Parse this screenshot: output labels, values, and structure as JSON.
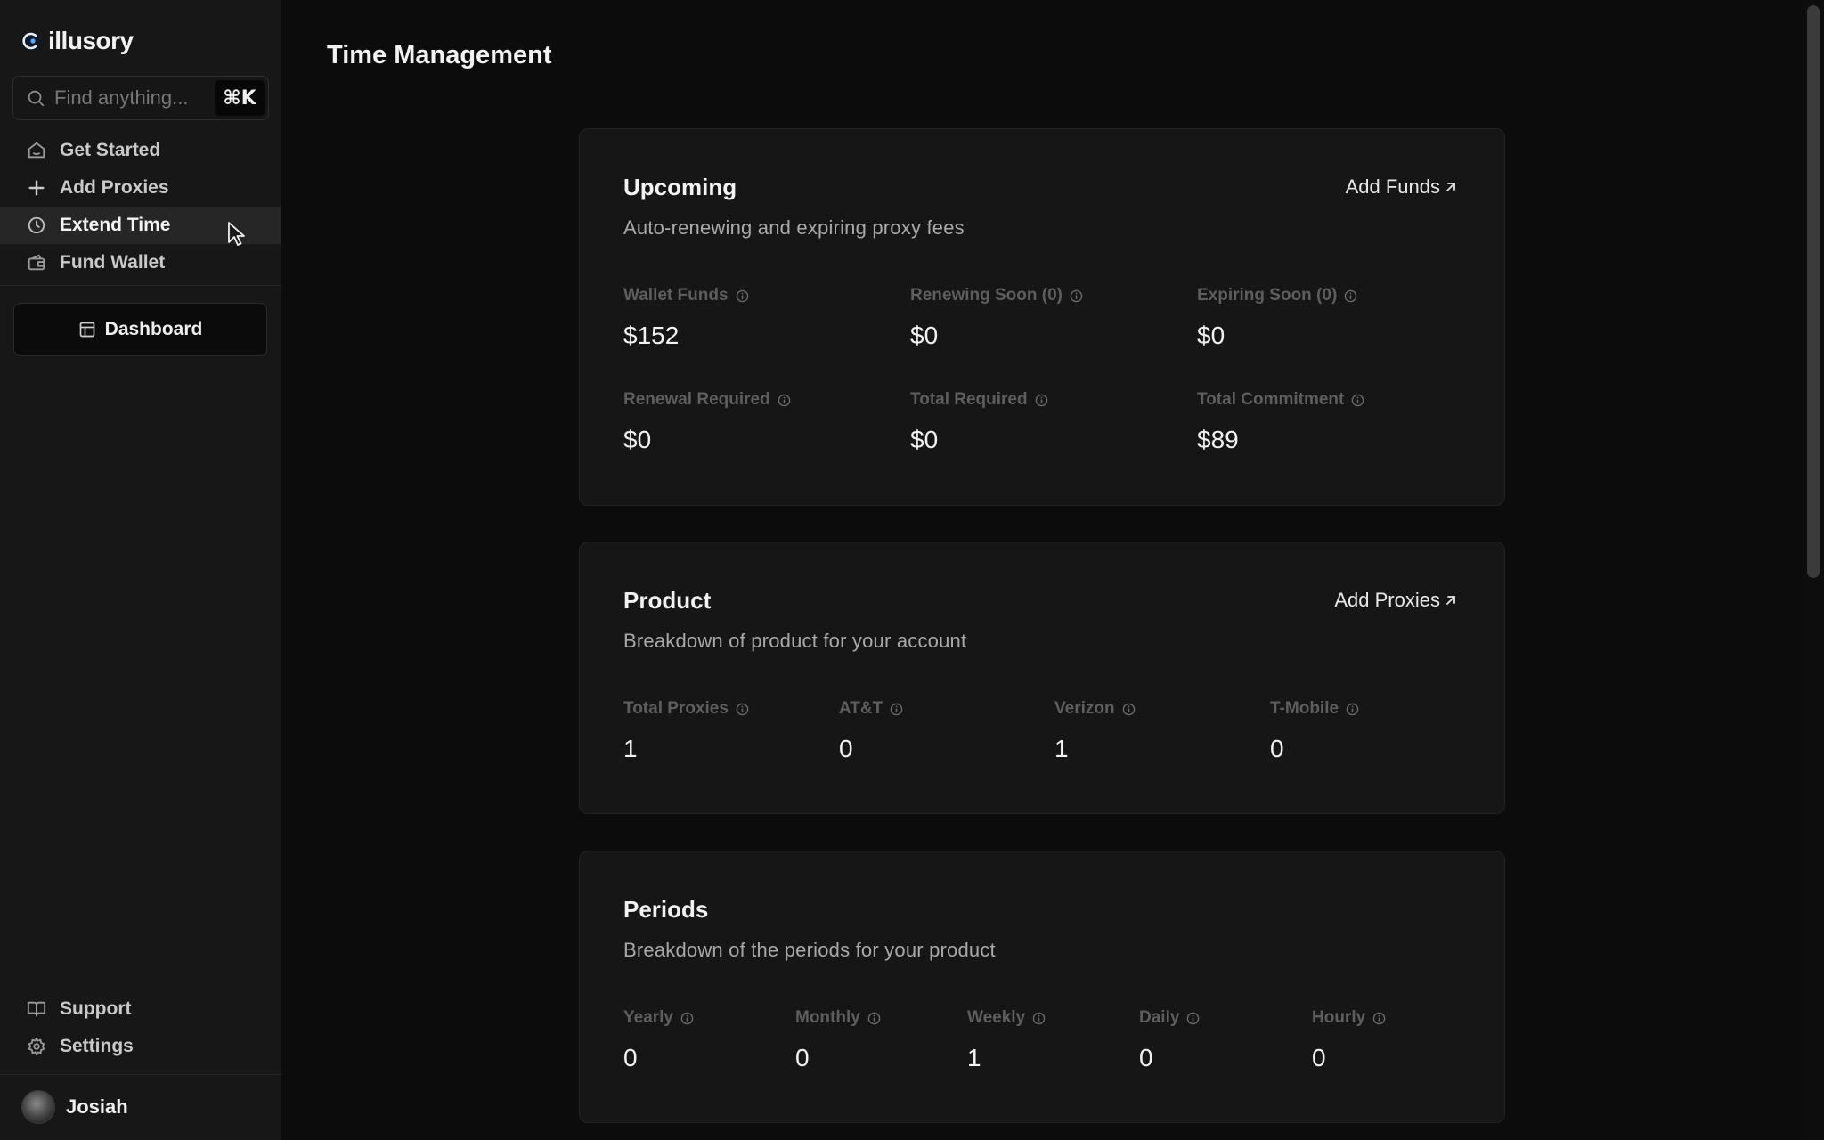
{
  "brand": {
    "name": "illusory"
  },
  "search": {
    "placeholder": "Find anything...",
    "shortcut": "⌘K"
  },
  "sidebar": {
    "nav": [
      {
        "label": "Get Started",
        "icon": "home-icon"
      },
      {
        "label": "Add Proxies",
        "icon": "plus-icon"
      },
      {
        "label": "Extend Time",
        "icon": "clock-icon",
        "active": true
      },
      {
        "label": "Fund Wallet",
        "icon": "wallet-icon"
      }
    ],
    "dashboard_label": "Dashboard",
    "bottom_nav": [
      {
        "label": "Support",
        "icon": "book-icon"
      },
      {
        "label": "Settings",
        "icon": "gear-icon"
      }
    ],
    "user": {
      "name": "Josiah"
    }
  },
  "page": {
    "title": "Time Management"
  },
  "upcoming": {
    "title": "Upcoming",
    "subtitle": "Auto-renewing and expiring proxy fees",
    "link": "Add Funds",
    "stats": [
      {
        "label": "Wallet Funds",
        "value": "$152"
      },
      {
        "label": "Renewing Soon (0)",
        "value": "$0"
      },
      {
        "label": "Expiring Soon (0)",
        "value": "$0"
      },
      {
        "label": "Renewal Required",
        "value": "$0"
      },
      {
        "label": "Total Required",
        "value": "$0"
      },
      {
        "label": "Total Commitment",
        "value": "$89"
      }
    ]
  },
  "product": {
    "title": "Product",
    "subtitle": "Breakdown of product for your account",
    "link": "Add Proxies",
    "stats": [
      {
        "label": "Total Proxies",
        "value": "1"
      },
      {
        "label": "AT&T",
        "value": "0"
      },
      {
        "label": "Verizon",
        "value": "1"
      },
      {
        "label": "T-Mobile",
        "value": "0"
      }
    ]
  },
  "periods": {
    "title": "Periods",
    "subtitle": "Breakdown of the periods for your product",
    "stats": [
      {
        "label": "Yearly",
        "value": "0"
      },
      {
        "label": "Monthly",
        "value": "0"
      },
      {
        "label": "Weekly",
        "value": "1"
      },
      {
        "label": "Daily",
        "value": "0"
      },
      {
        "label": "Hourly",
        "value": "0"
      }
    ]
  },
  "colors": {
    "background": "#0c0c0c",
    "sidebar": "#171717",
    "card": "#161616",
    "active_item": "#262626",
    "muted_label": "#5e5e5e"
  }
}
